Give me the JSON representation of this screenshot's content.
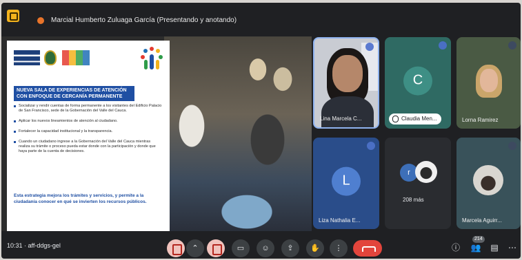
{
  "topbar": {
    "presenter_label": "Marcial Humberto Zuluaga García (Presentando y anotando)"
  },
  "slide": {
    "heading": "NUEVA SALA DE EXPERIENCIAS DE ATENCIÓN CON ENFOQUE DE CERCANÍA PERMANENTE",
    "bullets": [
      "Socializar y rendir cuentas de forma permanente a los visitantes del Edificio Palacio de San Francisco, sede de la Gobernación del Valle del Cauca.",
      "Aplicar los nuevos lineamientos de atención al ciudadano.",
      "Fortalecer la capacidad institucional y la transparencia.",
      "Cuando un ciudadano ingrese a la Gobernación del Valle del Cauca mientras realiza su trámite o proceso pueda estar donde con la participación y donde que haya parte de la cuenta de decisiones."
    ],
    "footer": "Esta estrategia mejora los trámites y servicios, y permite a la ciudadanía conocer en qué se invierten los recursos públicos."
  },
  "participants": [
    {
      "name": "Lina Marcela C...",
      "type": "video"
    },
    {
      "name": "Claudia Men...",
      "initial": "C",
      "type": "avatar",
      "accent": "#3e8f85"
    },
    {
      "name": "Lorna Ramirez",
      "type": "video"
    },
    {
      "name": "Liza Nathalia E...",
      "initial": "L",
      "type": "avatar",
      "accent": "#4f7fd0"
    },
    {
      "more_initial": "r",
      "more_count": "208 más",
      "type": "more"
    },
    {
      "name": "Marcela Aguirr...",
      "type": "photo"
    }
  ],
  "bottombar": {
    "time_code": "10:31  ·  aff-ddgs-gel",
    "participant_count": "214"
  },
  "colors": {
    "hangup": "#e2453c",
    "muted_ctrl": "#f1c3bd",
    "slide_accent": "#1f4fa3"
  }
}
